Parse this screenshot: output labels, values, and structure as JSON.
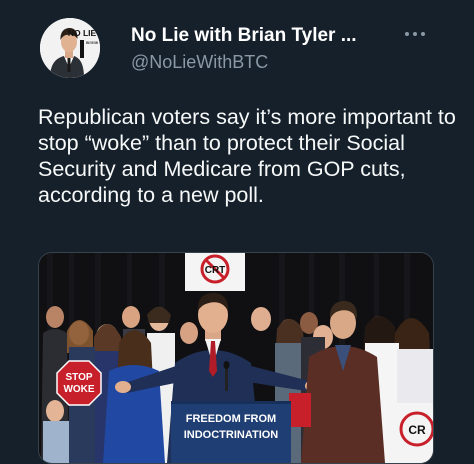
{
  "author": {
    "display_name": "No Lie with Brian Tyler ...",
    "handle": "@NoLieWithBTC",
    "avatar_logo_text": "NO LIE",
    "avatar_logo_subtext": "BRIAN TYLER COHEN"
  },
  "more_menu_icon": "more-horizontal-icon",
  "tweet": {
    "text": "Republican voters say it’s more important to stop “woke” than to protect their Social Security and Medicare from GOP cuts, according to a new poll."
  },
  "media": {
    "sign_crt": "CRT",
    "sign_stop": "STOP",
    "sign_woke": "WOKE",
    "podium_line1": "FREEDOM FROM",
    "podium_line2": "INDOCTRINATION",
    "sign_right_crt": "CR"
  },
  "colors": {
    "background": "#15202b",
    "secondary_text": "#8b98a5",
    "podium_blue": "#1f3e73",
    "sign_red": "#c8202a"
  }
}
